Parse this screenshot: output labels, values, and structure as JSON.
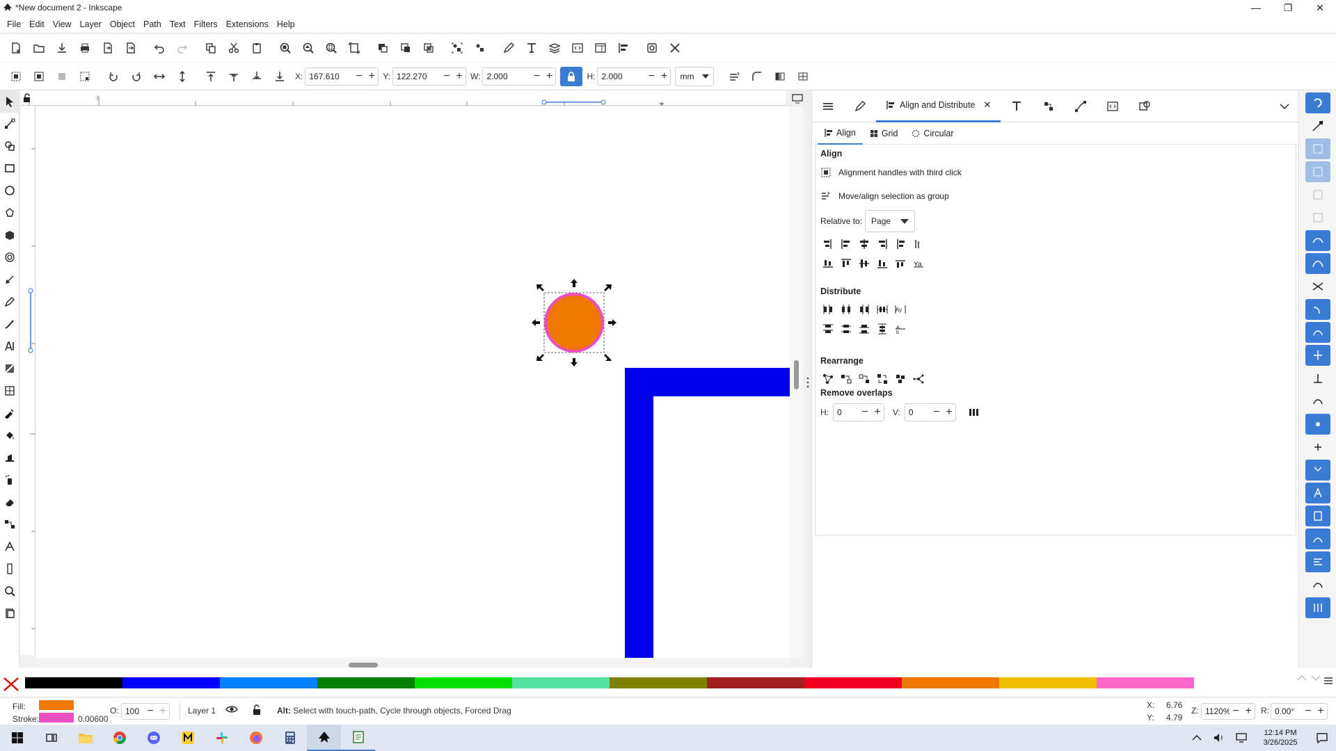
{
  "window": {
    "title": "*New document 2 - Inkscape"
  },
  "menu": [
    "File",
    "Edit",
    "View",
    "Layer",
    "Object",
    "Path",
    "Text",
    "Filters",
    "Extensions",
    "Help"
  ],
  "tool_controls": {
    "x_label": "X:",
    "x_value": "167.610",
    "y_label": "Y:",
    "y_value": "122.270",
    "w_label": "W:",
    "w_value": "2.000",
    "h_label": "H:",
    "h_value": "2.000",
    "unit": "mm"
  },
  "dock": {
    "tabs": [
      {
        "name": "layers-icon"
      },
      {
        "name": "fill-stroke-icon"
      },
      {
        "name": "align-icon",
        "label": "Align and Distribute",
        "active": true
      },
      {
        "name": "text-icon"
      },
      {
        "name": "xml-icon"
      },
      {
        "name": "path-effects-icon"
      },
      {
        "name": "objects-icon"
      },
      {
        "name": "transform-icon"
      }
    ],
    "subtabs": [
      "Align",
      "Grid",
      "Circular"
    ],
    "align_title": "Align",
    "option1": "Alignment handles with third click",
    "option2": "Move/align selection as group",
    "relative_label": "Relative to:",
    "relative_value": "Page",
    "distribute_title": "Distribute",
    "rearrange_title": "Rearrange",
    "remove_overlaps_title": "Remove overlaps",
    "h_label": "H:",
    "h_value": "0",
    "v_label": "V:",
    "v_value": "0"
  },
  "canvas": {
    "ruler_mark": "6",
    "selected_fill": "#f07800",
    "selected_stroke": "#e94fbf",
    "shape_color": "#0000ee"
  },
  "palette": {
    "colors": [
      "#000000",
      "#0000ff",
      "#0080ff",
      "#008000",
      "#00e000",
      "#55e0a0",
      "#808000",
      "#a02020",
      "#ee0020",
      "#f07800",
      "#f0c000",
      "#ff66cc"
    ]
  },
  "status": {
    "fill_label": "Fill:",
    "stroke_label": "Stroke:",
    "stroke_width": "0.00600",
    "opacity_label": "O:",
    "opacity_value": "100",
    "layer": "Layer 1",
    "message_bold": "Alt:",
    "message": " Select with touch-path, Cycle through objects, Forced Drag",
    "coord_x_label": "X:",
    "coord_x": "6.76",
    "coord_y_label": "Y:",
    "coord_y": "4.79",
    "zoom_label": "Z:",
    "zoom": "1120%",
    "rotate_label": "R:",
    "rotate": "0.00°"
  },
  "taskbar": {
    "time": "12:14 PM",
    "date": "3/26/2025"
  }
}
